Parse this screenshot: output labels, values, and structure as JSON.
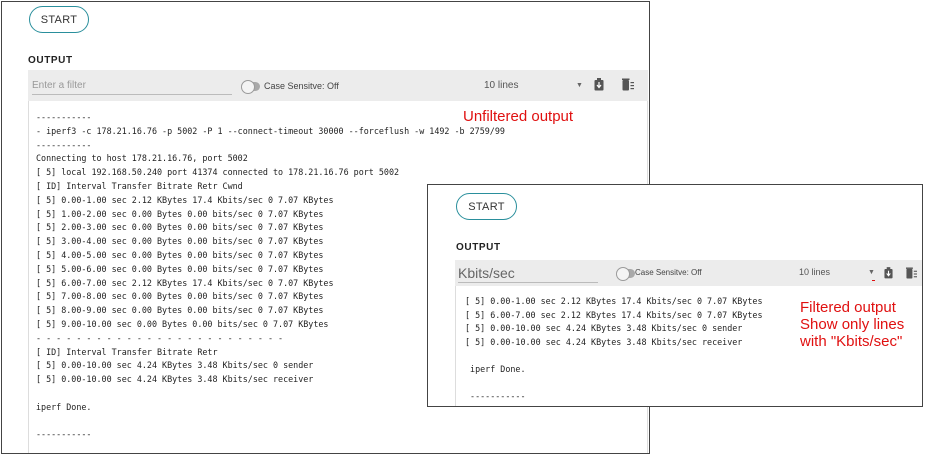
{
  "main": {
    "start_label": "START",
    "output_label": "OUTPUT",
    "filter": {
      "value": "",
      "placeholder": "Enter a filter"
    },
    "case_sensitive_label": "Case Sensitve: Off",
    "lines_select": "10 lines",
    "output_lines": [
      "-----------",
      "- iperf3 -c 178.21.16.76 -p 5002 -P 1 --connect-timeout 30000 --forceflush -w 1492 -b 2759/99",
      "-----------",
      "Connecting to host 178.21.16.76, port 5002",
      "[ 5] local 192.168.50.240 port 41374 connected to 178.21.16.76 port 5002",
      "[ ID] Interval Transfer Bitrate Retr Cwnd",
      "[ 5] 0.00-1.00 sec 2.12 KBytes 17.4 Kbits/sec 0 7.07 KBytes",
      "[ 5] 1.00-2.00 sec 0.00 Bytes 0.00 bits/sec 0 7.07 KBytes",
      "[ 5] 2.00-3.00 sec 0.00 Bytes 0.00 bits/sec 0 7.07 KBytes",
      "[ 5] 3.00-4.00 sec 0.00 Bytes 0.00 bits/sec 0 7.07 KBytes",
      "[ 5] 4.00-5.00 sec 0.00 Bytes 0.00 bits/sec 0 7.07 KBytes",
      "[ 5] 5.00-6.00 sec 0.00 Bytes 0.00 bits/sec 0 7.07 KBytes",
      "[ 5] 6.00-7.00 sec 2.12 KBytes 17.4 Kbits/sec 0 7.07 KBytes",
      "[ 5] 7.00-8.00 sec 0.00 Bytes 0.00 bits/sec 0 7.07 KBytes",
      "[ 5] 8.00-9.00 sec 0.00 Bytes 0.00 bits/sec 0 7.07 KBytes",
      "[ 5] 9.00-10.00 sec 0.00 Bytes 0.00 bits/sec 0 7.07 KBytes",
      "- - - - - - - - - - - - - - - - - - - - - - - - -",
      "[ ID] Interval Transfer Bitrate Retr",
      "[ 5] 0.00-10.00 sec 4.24 KBytes 3.48 Kbits/sec 0 sender",
      "[ 5] 0.00-10.00 sec 4.24 KBytes 3.48 Kbits/sec receiver",
      "",
      "iperf Done.",
      "",
      "-----------"
    ]
  },
  "filtered": {
    "start_label": "START",
    "output_label": "OUTPUT",
    "filter": {
      "value": "Kbits/sec",
      "placeholder": "Enter a filter"
    },
    "case_sensitive_label": "Case Sensitve: Off",
    "lines_select": "10 lines",
    "output_lines": [
      "[ 5] 0.00-1.00 sec 2.12 KBytes 17.4 Kbits/sec 0 7.07 KBytes",
      "[ 5] 6.00-7.00 sec 2.12 KBytes 17.4 Kbits/sec 0 7.07 KBytes",
      "[ 5] 0.00-10.00 sec 4.24 KBytes 3.48 Kbits/sec 0 sender",
      "[ 5] 0.00-10.00 sec 4.24 KBytes 3.48 Kbits/sec receiver",
      "",
      " iperf Done.",
      "",
      " -----------"
    ]
  },
  "annotations": {
    "unfiltered": "Unfiltered output",
    "filtered_lines": [
      "Filtered output",
      "Show only lines",
      "with \"Kbits/sec\""
    ]
  },
  "colors": {
    "accent_teal": "#2a8f9c",
    "annotation_red": "#e01010",
    "toolbar_gray": "#ececec"
  },
  "icons": {
    "download": "download-icon",
    "clear": "clear-output-icon",
    "dropdown": "chevron-down-icon"
  }
}
